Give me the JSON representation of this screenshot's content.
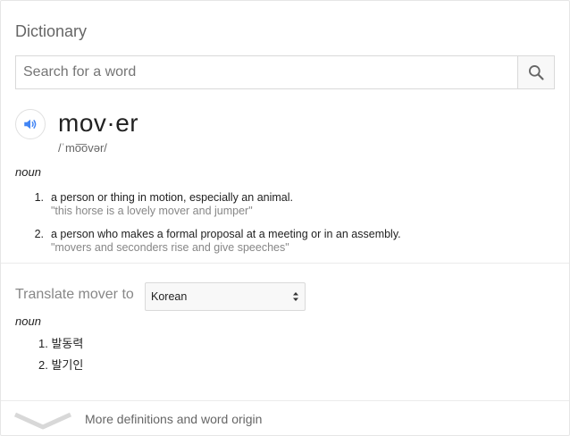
{
  "header": {
    "title": "Dictionary"
  },
  "search": {
    "placeholder": "Search for a word",
    "value": ""
  },
  "entry": {
    "word": "mov·er",
    "phonetic": "/ˈmo͞ovər/",
    "part_of_speech": "noun",
    "definitions": [
      {
        "number": "1.",
        "text": "a person or thing in motion, especially an animal.",
        "example": "\"this horse is a lovely mover and jumper\""
      },
      {
        "number": "2.",
        "text": "a person who makes a formal proposal at a meeting or in an assembly.",
        "example": "\"movers and seconders rise and give speeches\""
      }
    ]
  },
  "translate": {
    "label": "Translate mover to",
    "language": "Korean",
    "part_of_speech": "noun",
    "results": [
      {
        "number": "1.",
        "text": "발동력"
      },
      {
        "number": "2.",
        "text": "발기인"
      }
    ]
  },
  "footer": {
    "more_label": "More definitions and word origin"
  },
  "icons": {
    "search": "search-icon",
    "speaker": "speaker-icon",
    "select_arrows": "up-down-arrows-icon",
    "expand": "chevron-down-icon"
  },
  "colors": {
    "accent": "#4285f4",
    "muted": "#878787",
    "text": "#222222"
  }
}
